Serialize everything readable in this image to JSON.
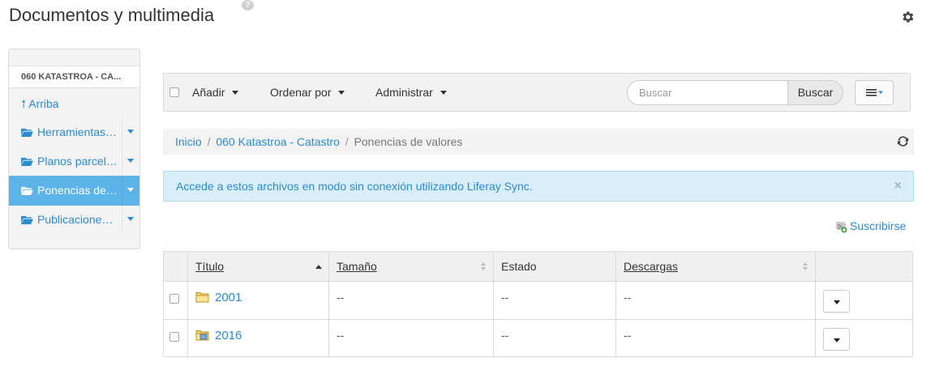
{
  "header": {
    "title": "Documentos y multimedia",
    "help_icon": "question-icon",
    "settings_icon": "gear-icon"
  },
  "sidebar": {
    "site_name": "060 KATASTROA - CA...",
    "up_label": "Arriba",
    "items": [
      {
        "label": "Herramientas de...",
        "icon": "folder-open-icon",
        "active": false
      },
      {
        "label": "Planos parcelarios",
        "icon": "folder-open-icon",
        "active": false
      },
      {
        "label": "Ponencias de valores",
        "icon": "folder-open-icon",
        "active": true
      },
      {
        "label": "Publicaciones de...",
        "icon": "folder-open-icon",
        "active": false
      }
    ]
  },
  "toolbar": {
    "add_label": "Añadir",
    "sort_label": "Ordenar por",
    "manage_label": "Administrar",
    "search_placeholder": "Buscar",
    "search_button": "Buscar"
  },
  "breadcrumb": {
    "items": [
      "Inicio",
      "060 Katastroa - Catastro"
    ],
    "current": "Ponencias de valores",
    "separator": "/"
  },
  "alert": {
    "message": "Accede a estos archivos en modo sin conexión utilizando Liferay Sync.",
    "close": "×"
  },
  "subscribe_label": "Suscribirse",
  "table": {
    "columns": {
      "title": "Título",
      "size": "Tamaño",
      "status": "Estado",
      "downloads": "Descargas"
    },
    "rows": [
      {
        "name": "2001",
        "icon": "folder-icon",
        "size": "--",
        "status": "--",
        "downloads": "--"
      },
      {
        "name": "2016",
        "icon": "shared-folder-icon",
        "size": "--",
        "status": "--",
        "downloads": "--"
      }
    ]
  },
  "colors": {
    "link": "#2a8ccf",
    "active_bg": "#5bb3e8",
    "alert_bg": "#d8eefa"
  }
}
